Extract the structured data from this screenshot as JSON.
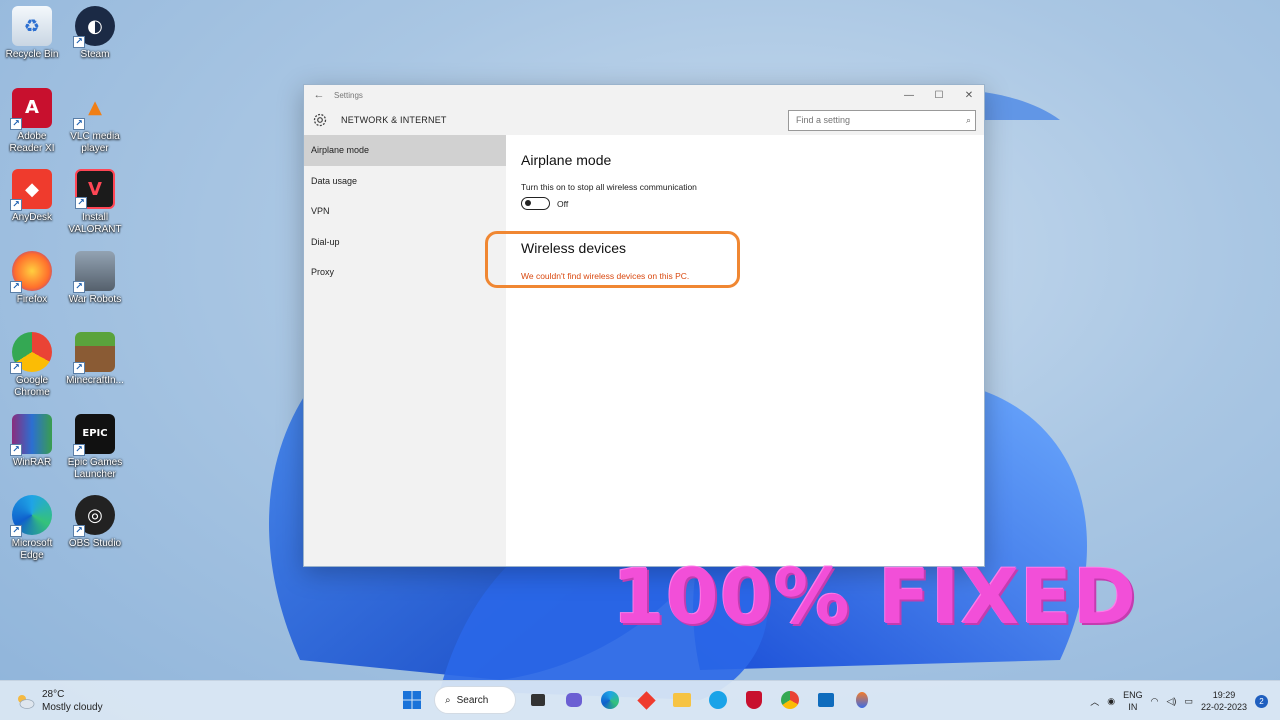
{
  "desktop": {
    "icons": [
      {
        "label": "Recycle Bin",
        "icon": "recycle-bin-icon"
      },
      {
        "label": "Steam",
        "icon": "steam-icon"
      },
      {
        "label": "Adobe Reader XI",
        "icon": "adobe-reader-icon"
      },
      {
        "label": "VLC media player",
        "icon": "vlc-icon"
      },
      {
        "label": "AnyDesk",
        "icon": "anydesk-icon"
      },
      {
        "label": "Install VALORANT",
        "icon": "valorant-icon"
      },
      {
        "label": "Firefox",
        "icon": "firefox-icon"
      },
      {
        "label": "War Robots",
        "icon": "war-robots-icon"
      },
      {
        "label": "Google Chrome",
        "icon": "chrome-icon"
      },
      {
        "label": "MinecraftIn...",
        "icon": "minecraft-icon"
      },
      {
        "label": "WinRAR",
        "icon": "winrar-icon"
      },
      {
        "label": "Epic Games Launcher",
        "icon": "epic-games-icon"
      },
      {
        "label": "Microsoft Edge",
        "icon": "edge-icon"
      },
      {
        "label": "OBS Studio",
        "icon": "obs-icon"
      }
    ]
  },
  "window": {
    "title": "Settings",
    "category": "NETWORK & INTERNET",
    "search_placeholder": "Find a setting",
    "sidebar": [
      {
        "label": "Airplane mode"
      },
      {
        "label": "Data usage"
      },
      {
        "label": "VPN"
      },
      {
        "label": "Dial-up"
      },
      {
        "label": "Proxy"
      }
    ],
    "airplane": {
      "heading": "Airplane mode",
      "description": "Turn this on to stop all wireless communication",
      "toggle_state": "Off"
    },
    "wireless": {
      "heading": "Wireless devices",
      "message": "We couldn't find wireless devices on this PC."
    }
  },
  "overlay": {
    "text": "100% FIXED"
  },
  "taskbar": {
    "weather_temp": "28°C",
    "weather_desc": "Mostly cloudy",
    "search_label": "Search",
    "lang_line1": "ENG",
    "lang_line2": "IN",
    "time": "19:29",
    "date": "22-02-2023",
    "notification_count": "2"
  },
  "colors": {
    "accent_orange": "#f08732",
    "error_text": "#d9480f",
    "overlay_pink": "#f24fd8"
  }
}
